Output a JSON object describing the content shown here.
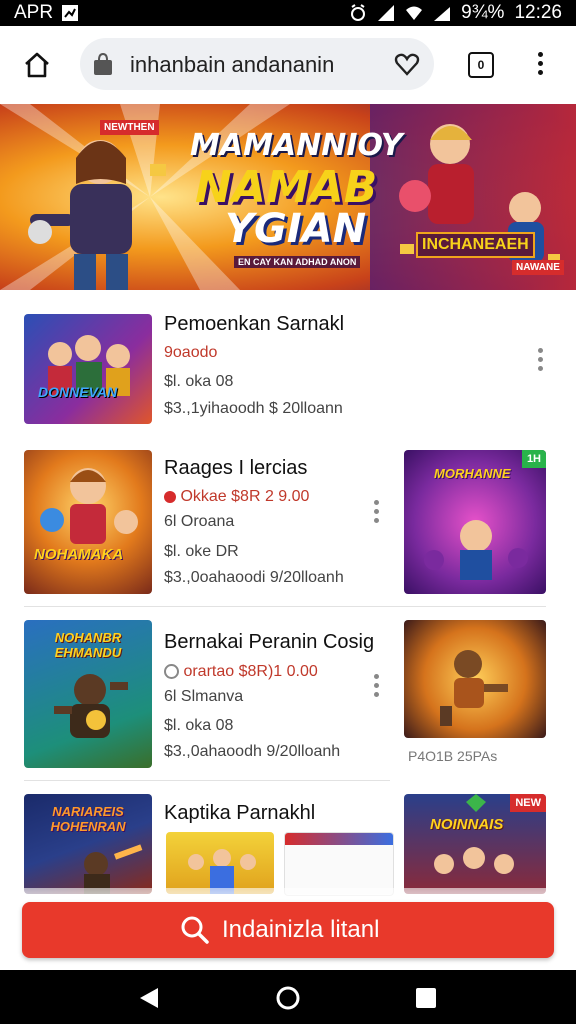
{
  "status_bar": {
    "carrier": "APR",
    "battery": "9¾%",
    "time": "12:26"
  },
  "toolbar": {
    "url": "inhanbain andananin",
    "tab_count": "0"
  },
  "banner": {
    "line1": "MAMANNIOY",
    "line2": "NAMAB",
    "line3": "YGIAN",
    "sub": "INCHANEAEH",
    "tag_left": "NEWTHEN",
    "tag_right": "NAWANE",
    "strap": "EN CAY KAN ADHAD ANON"
  },
  "products": [
    {
      "title": "Pemoenkan Sarnakl",
      "price": "9oaodo",
      "line1": "$l. oka 08",
      "line2": "$3.,1yihaoodh   $ 20lloann",
      "thumb_text": "DONNEVAN"
    },
    {
      "title": "Raages I lercias",
      "price": "Okkae $8R 2 9.00",
      "line1": "6l Oroana",
      "line2": "$l. oke DR",
      "line3": "$3.,0oahaoodi   9/20lloanh",
      "thumb_text": "NOHAMAKA",
      "side_thumb_text": "MORHANNE",
      "side_badge": "1H"
    },
    {
      "title": "Bernakai Peranin Cosig",
      "price": "orartao $8R)1 0.00",
      "line1": "6l Slmanva",
      "line2": "$l. oka 08",
      "line3": "$3.,0ahaoodh   9/20lloanh",
      "thumb_text": "NOHANBR EHMANDU",
      "side_caption": "P4O1B 25PAs"
    },
    {
      "title": "Kaptika Parnakhl",
      "thumb_text": "NARIAREIS HOHENRAN",
      "side_thumb_text": "NOINNAIS",
      "side_badge": "NEW"
    }
  ],
  "search_button": {
    "label": "Indainizla litanl"
  }
}
